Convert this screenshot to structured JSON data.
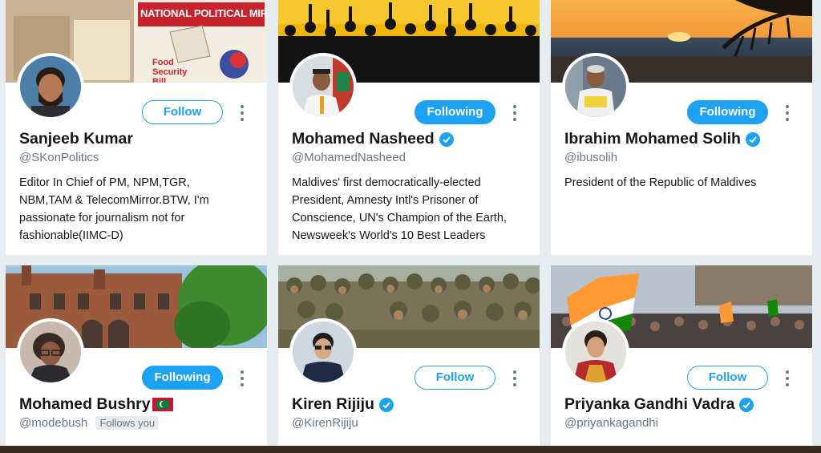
{
  "cards": [
    {
      "banner_text": "NATIONAL POLITICAL MIRROR",
      "banner_subtext": "Food Security Bill",
      "follow_label": "Follow",
      "name": "Sanjeeb Kumar",
      "handle": "@SKonPolitics",
      "bio_lines": [
        "Editor In Chief of PM, NPM,TGR,",
        "NBM,TAM & TelecomMirror.BTW, I'm",
        "passionate for journalism not for",
        "fashionable(IIMC-D)"
      ]
    },
    {
      "follow_label": "Following",
      "name": "Mohamed Nasheed",
      "handle": "@MohamedNasheed",
      "bio_lines": [
        "Maldives' first democratically-elected",
        "President, Amnesty Intl's Prisoner of",
        "Conscience, UN's Champion of the Earth,",
        "Newsweek's World's 10 Best Leaders"
      ]
    },
    {
      "follow_label": "Following",
      "name": "Ibrahim Mohamed Solih",
      "handle": "@ibusolih",
      "bio_lines": [
        "President of the Republic of Maldives"
      ]
    },
    {
      "follow_label": "Following",
      "name": "Mohamed Bushry",
      "handle": "@modebush",
      "follows_you": "Follows you"
    },
    {
      "follow_label": "Follow",
      "name": "Kiren Rijiju",
      "handle": "@KirenRijiju"
    },
    {
      "follow_label": "Follow",
      "name": "Priyanka Gandhi Vadra",
      "handle": "@priyankagandhi"
    }
  ],
  "colors": {
    "accent": "#1da1f2",
    "muted": "#657786",
    "background": "#e6ecf0"
  }
}
